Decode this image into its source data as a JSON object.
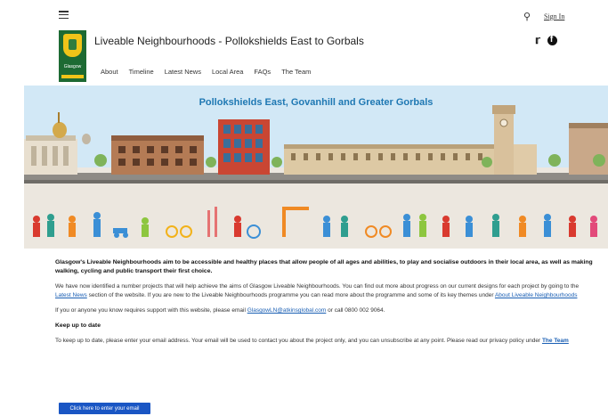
{
  "header": {
    "search_icon": "search-icon",
    "signin_label": "Sign In",
    "site_title": "Liveable Neighbourhoods - Pollokshields East to Gorbals",
    "logo_text": "Glasgow",
    "social": {
      "twitter_icon": "twitter-icon",
      "facebook_icon": "facebook-icon"
    }
  },
  "nav": {
    "items": [
      "About",
      "Timeline",
      "Latest News",
      "Local Area",
      "FAQs",
      "The Team"
    ]
  },
  "banner": {
    "title": "Pollokshields East, Govanhill and Greater Gorbals"
  },
  "content": {
    "intro": "Glasgow's Liveable Neighbourhoods aim to be accessible and healthy places that allow people of all ages and abilities, to play and socialise outdoors in their local area, as well as making walking, cycling and public transport their first choice.",
    "p1_part1": "We have now identified a number projects that will help achieve the aims of Glasgow Liveable Neighbourhoods. You can find out more about progress on our current designs for each project by going to the",
    "p1_link1": "Latest News",
    "p1_part2": "section of the website. If you are new to the Liveable Neighbourhoods programme you can read more about the programme and some of its key themes under",
    "p1_link2": "About Liveable Neighbourhoods",
    "p2_part1": "If you or anyone you know requires support with this website, please email",
    "p2_email": "GlasgowLN@atkinsglobal.com",
    "p2_part2": "or call 0800 002 9064.",
    "keep_heading": "Keep up to date",
    "p3_part1": "To keep up to date, please enter your email address. Your email will be used to contact you about the project only, and you can unsubscribe at any point. Please read our privacy policy under",
    "p3_link": "The Team",
    "cta_label": "Click here to enter your email"
  },
  "colors": {
    "brand_green": "#1d6a33",
    "banner_title": "#1f78b3",
    "link": "#1a5fb4",
    "button": "#1a56c4"
  }
}
